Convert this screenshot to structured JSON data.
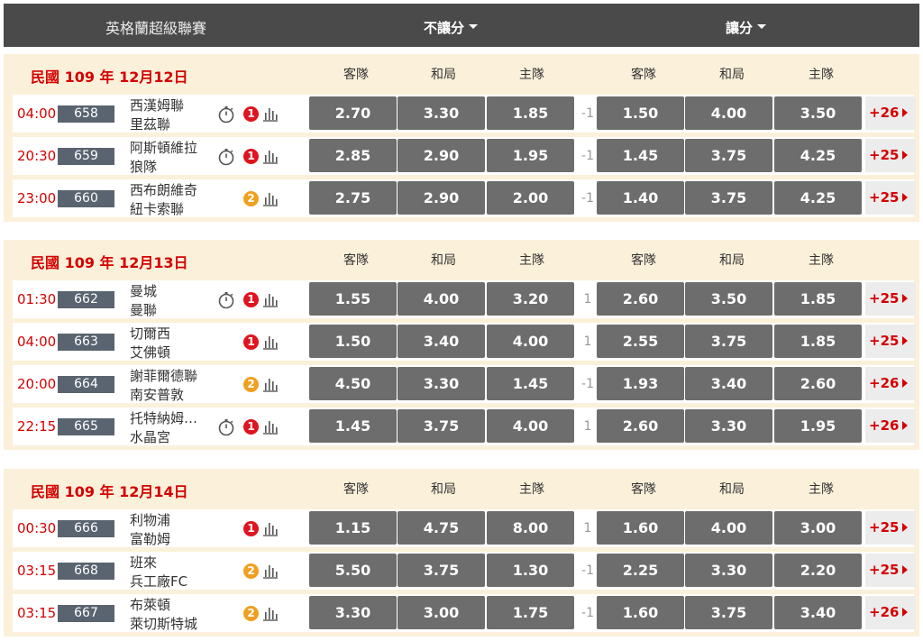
{
  "header": {
    "league": "英格蘭超級聯賽",
    "tab_no_handicap": "不讓分",
    "tab_handicap": "讓分"
  },
  "columns": [
    "客隊",
    "和局",
    "主隊",
    "客隊",
    "和局",
    "主隊"
  ],
  "colors": {
    "date_red": "#d40000",
    "odds_bg": "#6d6d6d",
    "section_bg": "#fbf0da",
    "header_bg": "#4a4a4a"
  },
  "sections": [
    {
      "date": "民國 109 年 12月12日",
      "matches": [
        {
          "time": "04:00",
          "code": "658",
          "away": "西漢姆聯",
          "home": "里茲聯",
          "timer": true,
          "badge": "1",
          "odds": [
            "2.70",
            "3.30",
            "1.85"
          ],
          "handicap": "-1",
          "hodds": [
            "1.50",
            "4.00",
            "3.50"
          ],
          "more": "+26"
        },
        {
          "time": "20:30",
          "code": "659",
          "away": "阿斯頓維拉",
          "home": "狼隊",
          "timer": true,
          "badge": "1",
          "odds": [
            "2.85",
            "2.90",
            "1.95"
          ],
          "handicap": "-1",
          "hodds": [
            "1.45",
            "3.75",
            "4.25"
          ],
          "more": "+25"
        },
        {
          "time": "23:00",
          "code": "660",
          "away": "西布朗維奇",
          "home": "紐卡索聯",
          "timer": false,
          "badge": "2",
          "odds": [
            "2.75",
            "2.90",
            "2.00"
          ],
          "handicap": "-1",
          "hodds": [
            "1.40",
            "3.75",
            "4.25"
          ],
          "more": "+25"
        }
      ]
    },
    {
      "date": "民國 109 年 12月13日",
      "matches": [
        {
          "time": "01:30",
          "code": "662",
          "away": "曼城",
          "home": "曼聯",
          "timer": true,
          "badge": "1",
          "odds": [
            "1.55",
            "4.00",
            "3.20"
          ],
          "handicap": "1",
          "hodds": [
            "2.60",
            "3.50",
            "1.85"
          ],
          "more": "+25"
        },
        {
          "time": "04:00",
          "code": "663",
          "away": "切爾西",
          "home": "艾佛頓",
          "timer": false,
          "badge": "1",
          "odds": [
            "1.50",
            "3.40",
            "4.00"
          ],
          "handicap": "1",
          "hodds": [
            "2.55",
            "3.75",
            "1.85"
          ],
          "more": "+25"
        },
        {
          "time": "20:00",
          "code": "664",
          "away": "謝菲爾德聯",
          "home": "南安普敦",
          "timer": false,
          "badge": "2",
          "odds": [
            "4.50",
            "3.30",
            "1.45"
          ],
          "handicap": "-1",
          "hodds": [
            "1.93",
            "3.40",
            "2.60"
          ],
          "more": "+26"
        },
        {
          "time": "22:15",
          "code": "665",
          "away": "托特納姆…",
          "home": "水晶宮",
          "timer": true,
          "badge": "1",
          "odds": [
            "1.45",
            "3.75",
            "4.00"
          ],
          "handicap": "1",
          "hodds": [
            "2.60",
            "3.30",
            "1.95"
          ],
          "more": "+26"
        }
      ]
    },
    {
      "date": "民國 109 年 12月14日",
      "matches": [
        {
          "time": "00:30",
          "code": "666",
          "away": "利物浦",
          "home": "富勒姆",
          "timer": false,
          "badge": "1",
          "odds": [
            "1.15",
            "4.75",
            "8.00"
          ],
          "handicap": "1",
          "hodds": [
            "1.60",
            "4.00",
            "3.00"
          ],
          "more": "+25"
        },
        {
          "time": "03:15",
          "code": "668",
          "away": "班來",
          "home": "兵工廠FC",
          "timer": false,
          "badge": "2",
          "odds": [
            "5.50",
            "3.75",
            "1.30"
          ],
          "handicap": "-1",
          "hodds": [
            "2.25",
            "3.30",
            "2.20"
          ],
          "more": "+25"
        },
        {
          "time": "03:15",
          "code": "667",
          "away": "布萊頓",
          "home": "萊切斯特城",
          "timer": false,
          "badge": "2",
          "odds": [
            "3.30",
            "3.00",
            "1.75"
          ],
          "handicap": "-1",
          "hodds": [
            "1.60",
            "3.75",
            "3.40"
          ],
          "more": "+26"
        }
      ]
    }
  ]
}
